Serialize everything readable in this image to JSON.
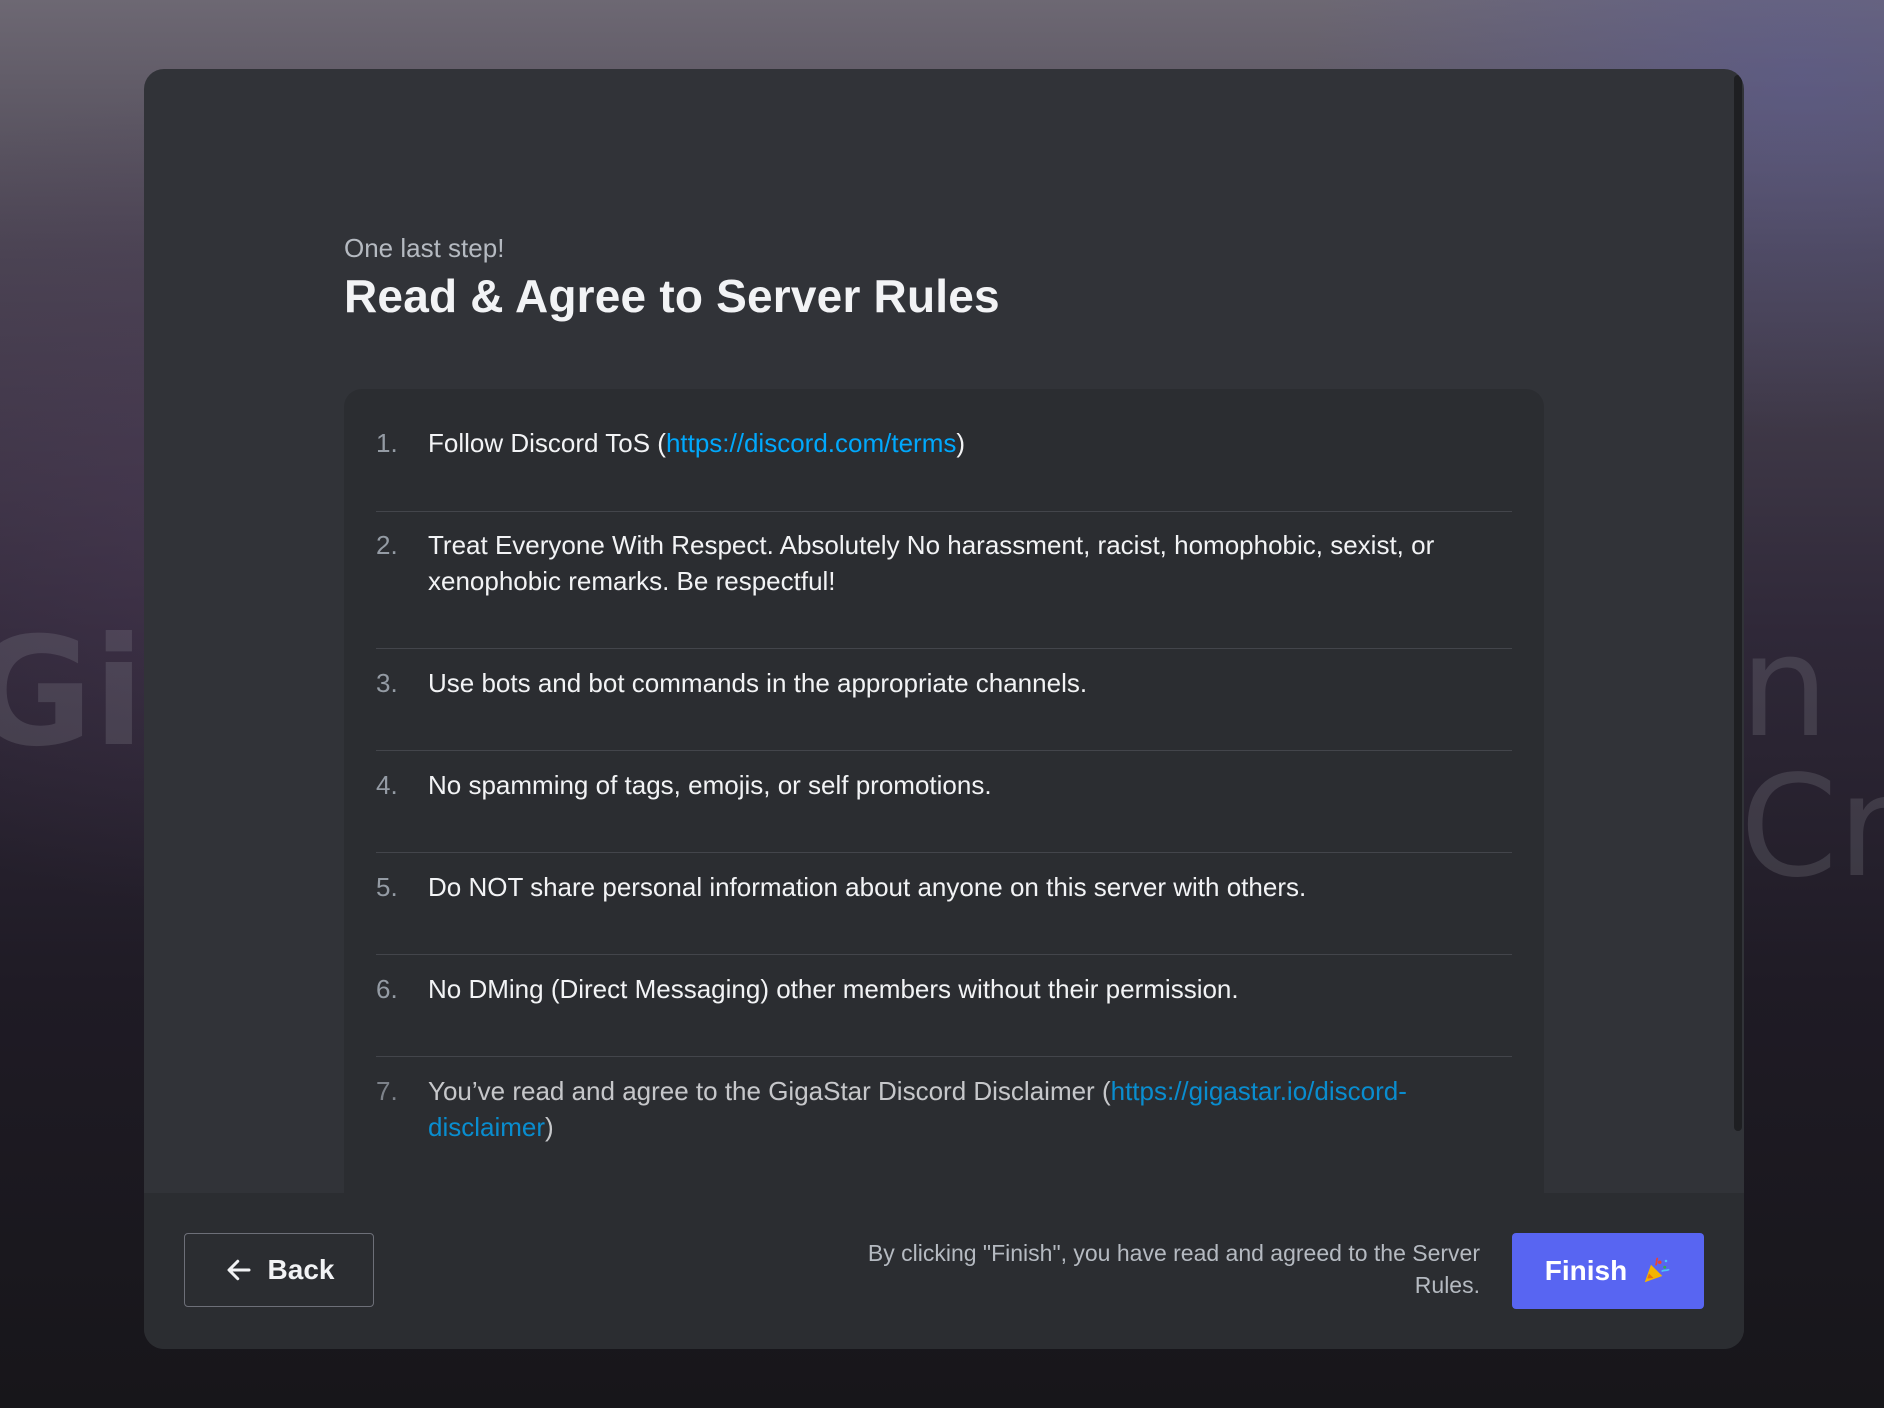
{
  "background": {
    "left_text": "Giga",
    "right_text": "n Cr"
  },
  "dialog": {
    "eyebrow": "One last step!",
    "title": "Read & Agree to Server Rules",
    "rules": [
      {
        "number": "1.",
        "text_before": "Follow Discord ToS (",
        "link": "https://discord.com/terms",
        "text_after": ")"
      },
      {
        "number": "2.",
        "text": "Treat Everyone With Respect. Absolutely No harassment, racist, homophobic, sexist, or xenophobic remarks. Be respectful!"
      },
      {
        "number": "3.",
        "text": "Use bots and bot commands in the appropriate channels."
      },
      {
        "number": "4.",
        "text": "No spamming of tags, emojis, or self promotions."
      },
      {
        "number": "5.",
        "text": "Do NOT share personal information about anyone on this server with others."
      },
      {
        "number": "6.",
        "text": "No DMing (Direct Messaging) other members without their permission."
      },
      {
        "number": "7.",
        "text_before": "You’ve read and agree to the GigaStar Discord Disclaimer (",
        "link": "https://gigastar.io/discord-disclaimer",
        "text_after": ")"
      }
    ]
  },
  "footer": {
    "back_label": "Back",
    "agree_note": "By clicking \"Finish\", you have read and agreed to the Server Rules.",
    "finish_label": "Finish"
  },
  "icons": {
    "back": "arrow-left-icon",
    "finish": "party-popper-icon"
  },
  "colors": {
    "accent": "#5865f2",
    "link": "#00a8fc",
    "modal_bg": "#313338",
    "panel_bg": "#2b2d31"
  }
}
